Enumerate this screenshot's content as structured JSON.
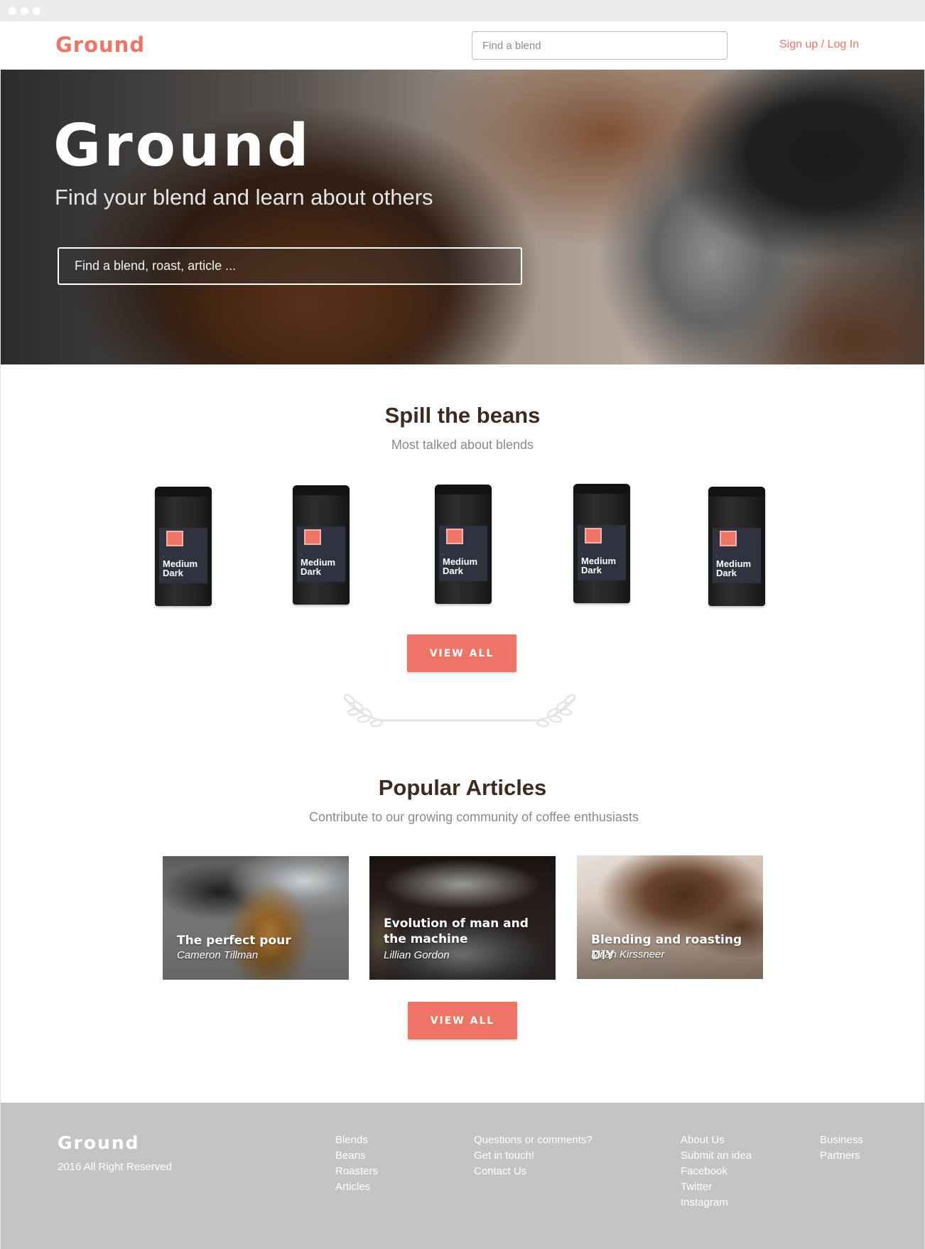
{
  "nav": {
    "logo": "Ground",
    "search_placeholder": "Find a blend",
    "signup_label": "Sign up",
    "separator": " / ",
    "login_label": "Log In"
  },
  "hero": {
    "title": "Ground",
    "subtitle": "Find your blend and learn about others",
    "search_placeholder": "Find a blend, roast, article ..."
  },
  "blends": {
    "heading": "Spill the beans",
    "subheading": "Most talked about blends",
    "items": [
      {
        "roast": "Medium Dark",
        "line1": "Medium",
        "line2": "Dark"
      },
      {
        "roast": "Medium Dark",
        "line1": "Medium",
        "line2": "Dark"
      },
      {
        "roast": "Medium Dark",
        "line1": "Medium",
        "line2": "Dark"
      },
      {
        "roast": "Medium Dark",
        "line1": "Medium",
        "line2": "Dark"
      },
      {
        "roast": "Medium Dark",
        "line1": "Medium",
        "line2": "Dark"
      }
    ],
    "view_all_label": "VIEW ALL"
  },
  "articles": {
    "heading": "Popular Articles",
    "subheading": "Contribute to our growing community of coffee enthusiasts",
    "items": [
      {
        "title": "The perfect pour",
        "author": "Cameron Tillman"
      },
      {
        "title": "Evolution of man and the machine",
        "author": "Lillian Gordon"
      },
      {
        "title": "Blending and roasting DIY",
        "author": "Milan Kirssneer"
      }
    ],
    "view_all_label": "VIEW ALL"
  },
  "footer": {
    "logo": "Ground",
    "copyright": "2016 All Right Reserved",
    "col1": [
      "Blends",
      "Beans",
      "Roasters",
      "Articles"
    ],
    "col2": [
      "Questions or comments?",
      "Get in touch!",
      "Contact Us"
    ],
    "col3": [
      "About Us",
      "Submit an idea",
      "Facebook",
      "Twitter",
      "Instagram"
    ],
    "col4": [
      "Business",
      "Partners"
    ]
  },
  "colors": {
    "accent": "#ee7466",
    "heading": "#3f2a20",
    "footer_bg": "#c4c4c4"
  }
}
